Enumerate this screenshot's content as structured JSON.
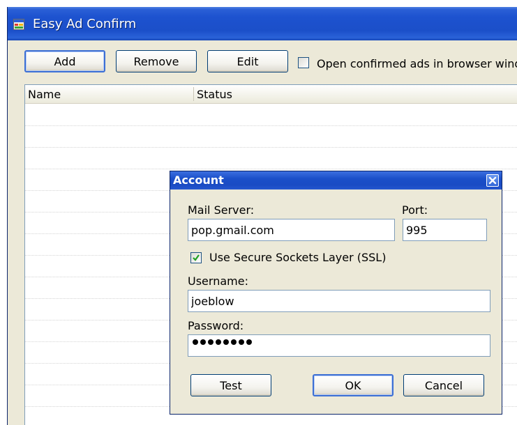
{
  "window": {
    "title": "Easy Ad Confirm"
  },
  "toolbar": {
    "add_label": "Add",
    "remove_label": "Remove",
    "edit_label": "Edit",
    "open_checkbox_label": "Open confirmed ads in browser windo",
    "open_checked": false
  },
  "list": {
    "columns": [
      "Name",
      "Status"
    ]
  },
  "dialog": {
    "title": "Account",
    "mail_server_label": "Mail Server:",
    "mail_server_value": "pop.gmail.com",
    "port_label": "Port:",
    "port_value": "995",
    "ssl_label": "Use Secure Sockets Layer (SSL)",
    "ssl_checked": true,
    "username_label": "Username:",
    "username_value": "joeblow",
    "password_label": "Password:",
    "password_length": 8,
    "test_label": "Test",
    "ok_label": "OK",
    "cancel_label": "Cancel"
  },
  "icons": {
    "app": "app-window-icon",
    "close": "close-icon",
    "check": "checkmark-icon"
  },
  "colors": {
    "title_bar": "#1b4fc9",
    "check_mark": "#21a121"
  }
}
